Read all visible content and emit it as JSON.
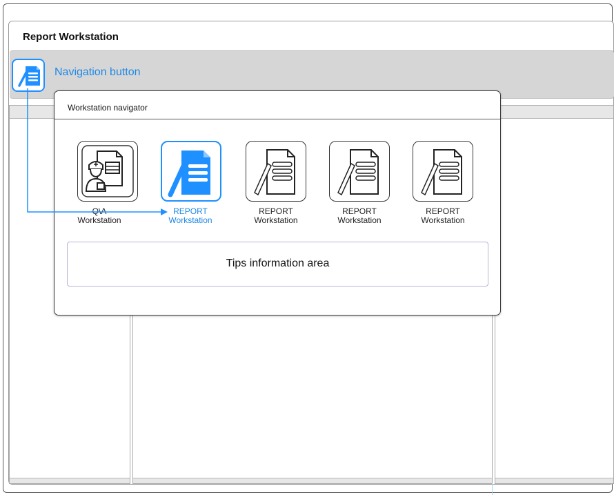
{
  "app": {
    "title": "Report  Workstation"
  },
  "nav_bar": {
    "button_label": "Navigation button"
  },
  "navigator": {
    "title": "Workstation navigator",
    "items": [
      {
        "line1": "Q\\A",
        "line2": "Workstation",
        "icon": "doctor-document-icon",
        "active": false
      },
      {
        "line1": "REPORT",
        "line2": "Workstation",
        "icon": "report-document-icon",
        "active": true
      },
      {
        "line1": "REPORT",
        "line2": "Workstation",
        "icon": "report-document-icon",
        "active": false
      },
      {
        "line1": "REPORT",
        "line2": "Workstation",
        "icon": "report-document-icon",
        "active": false
      },
      {
        "line1": "REPORT",
        "line2": "Workstation",
        "icon": "report-document-icon",
        "active": false
      }
    ],
    "tips": "Tips information area"
  },
  "colors": {
    "accent": "#1e90ff",
    "bar": "#d6d6d6",
    "border": "#333333"
  }
}
